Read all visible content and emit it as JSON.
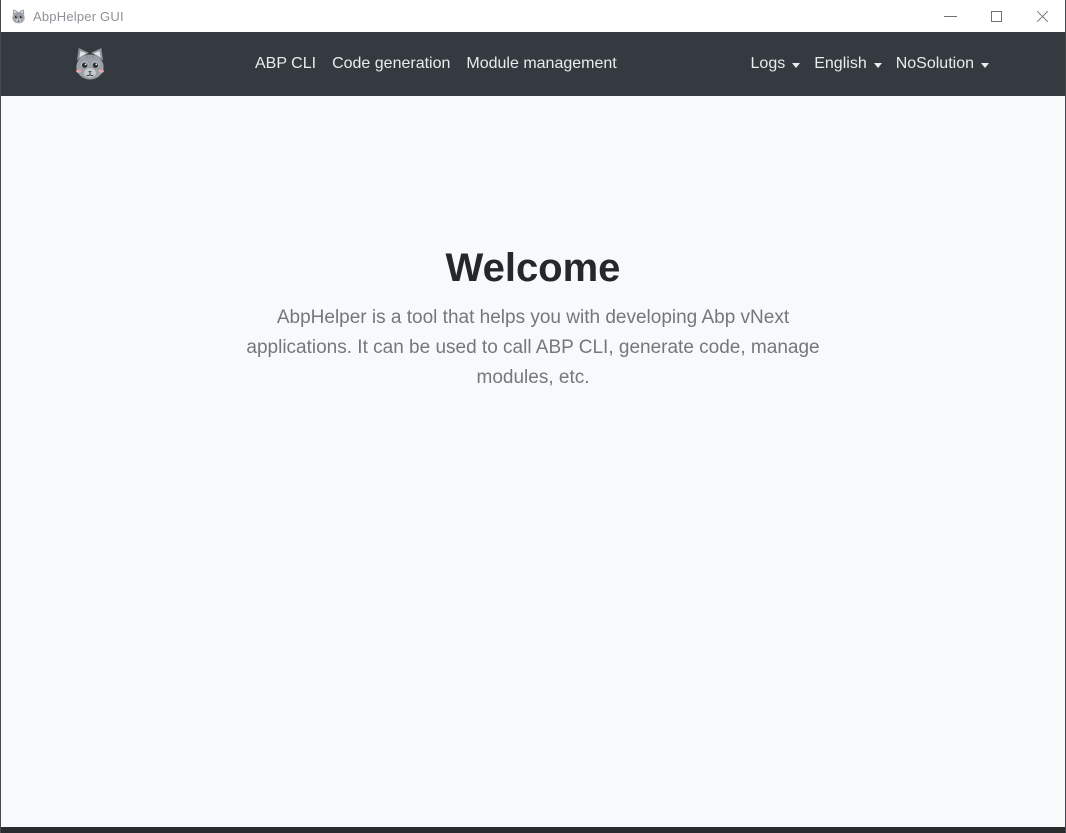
{
  "window": {
    "title": "AbpHelper GUI"
  },
  "titlebar_controls": {
    "minimize": "minimize",
    "maximize": "maximize",
    "close": "close"
  },
  "navbar": {
    "brand_icon": "cat-logo-icon",
    "links": [
      {
        "label": "ABP CLI"
      },
      {
        "label": "Code generation"
      },
      {
        "label": "Module management"
      }
    ],
    "dropdowns": [
      {
        "label": "Logs"
      },
      {
        "label": "English"
      },
      {
        "label": "NoSolution"
      }
    ]
  },
  "main": {
    "heading": "Welcome",
    "description_lines": [
      "AbpHelper is a tool that helps you with developing Abp vNext",
      "applications. It can be used to call ABP CLI, generate code, manage",
      "modules, etc."
    ]
  },
  "colors": {
    "navbar_bg": "#343a40",
    "navbar_text": "#e9ebed",
    "main_bg": "#f8f9fa",
    "heading_text": "#24272c",
    "body_text": "#73787d",
    "titlebar_bg": "#ffffff",
    "titlebar_text": "#8e9296",
    "log_panel_edge": "#2b2c2e"
  }
}
